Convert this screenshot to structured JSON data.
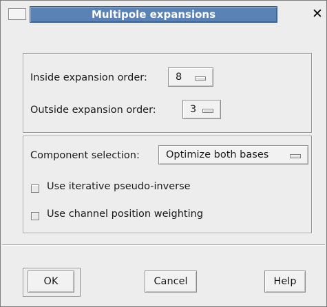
{
  "window": {
    "title": "Multipole expansions"
  },
  "orders": {
    "inside_label": "Inside  expansion order:",
    "inside_value": "8",
    "outside_label": "Outside expansion order:",
    "outside_value": "3"
  },
  "components": {
    "selection_label": "Component selection:",
    "selection_value": "Optimize both bases",
    "iterative_label": "Use iterative pseudo-inverse",
    "iterative_checked": false,
    "weighting_label": "Use channel position weighting",
    "weighting_checked": false
  },
  "buttons": {
    "ok": "OK",
    "cancel": "Cancel",
    "help": "Help"
  },
  "icons": {
    "menu": "window-menu-icon",
    "close": "close-icon"
  },
  "colors": {
    "title_bar": "#5a82b4",
    "background": "#ededed"
  }
}
